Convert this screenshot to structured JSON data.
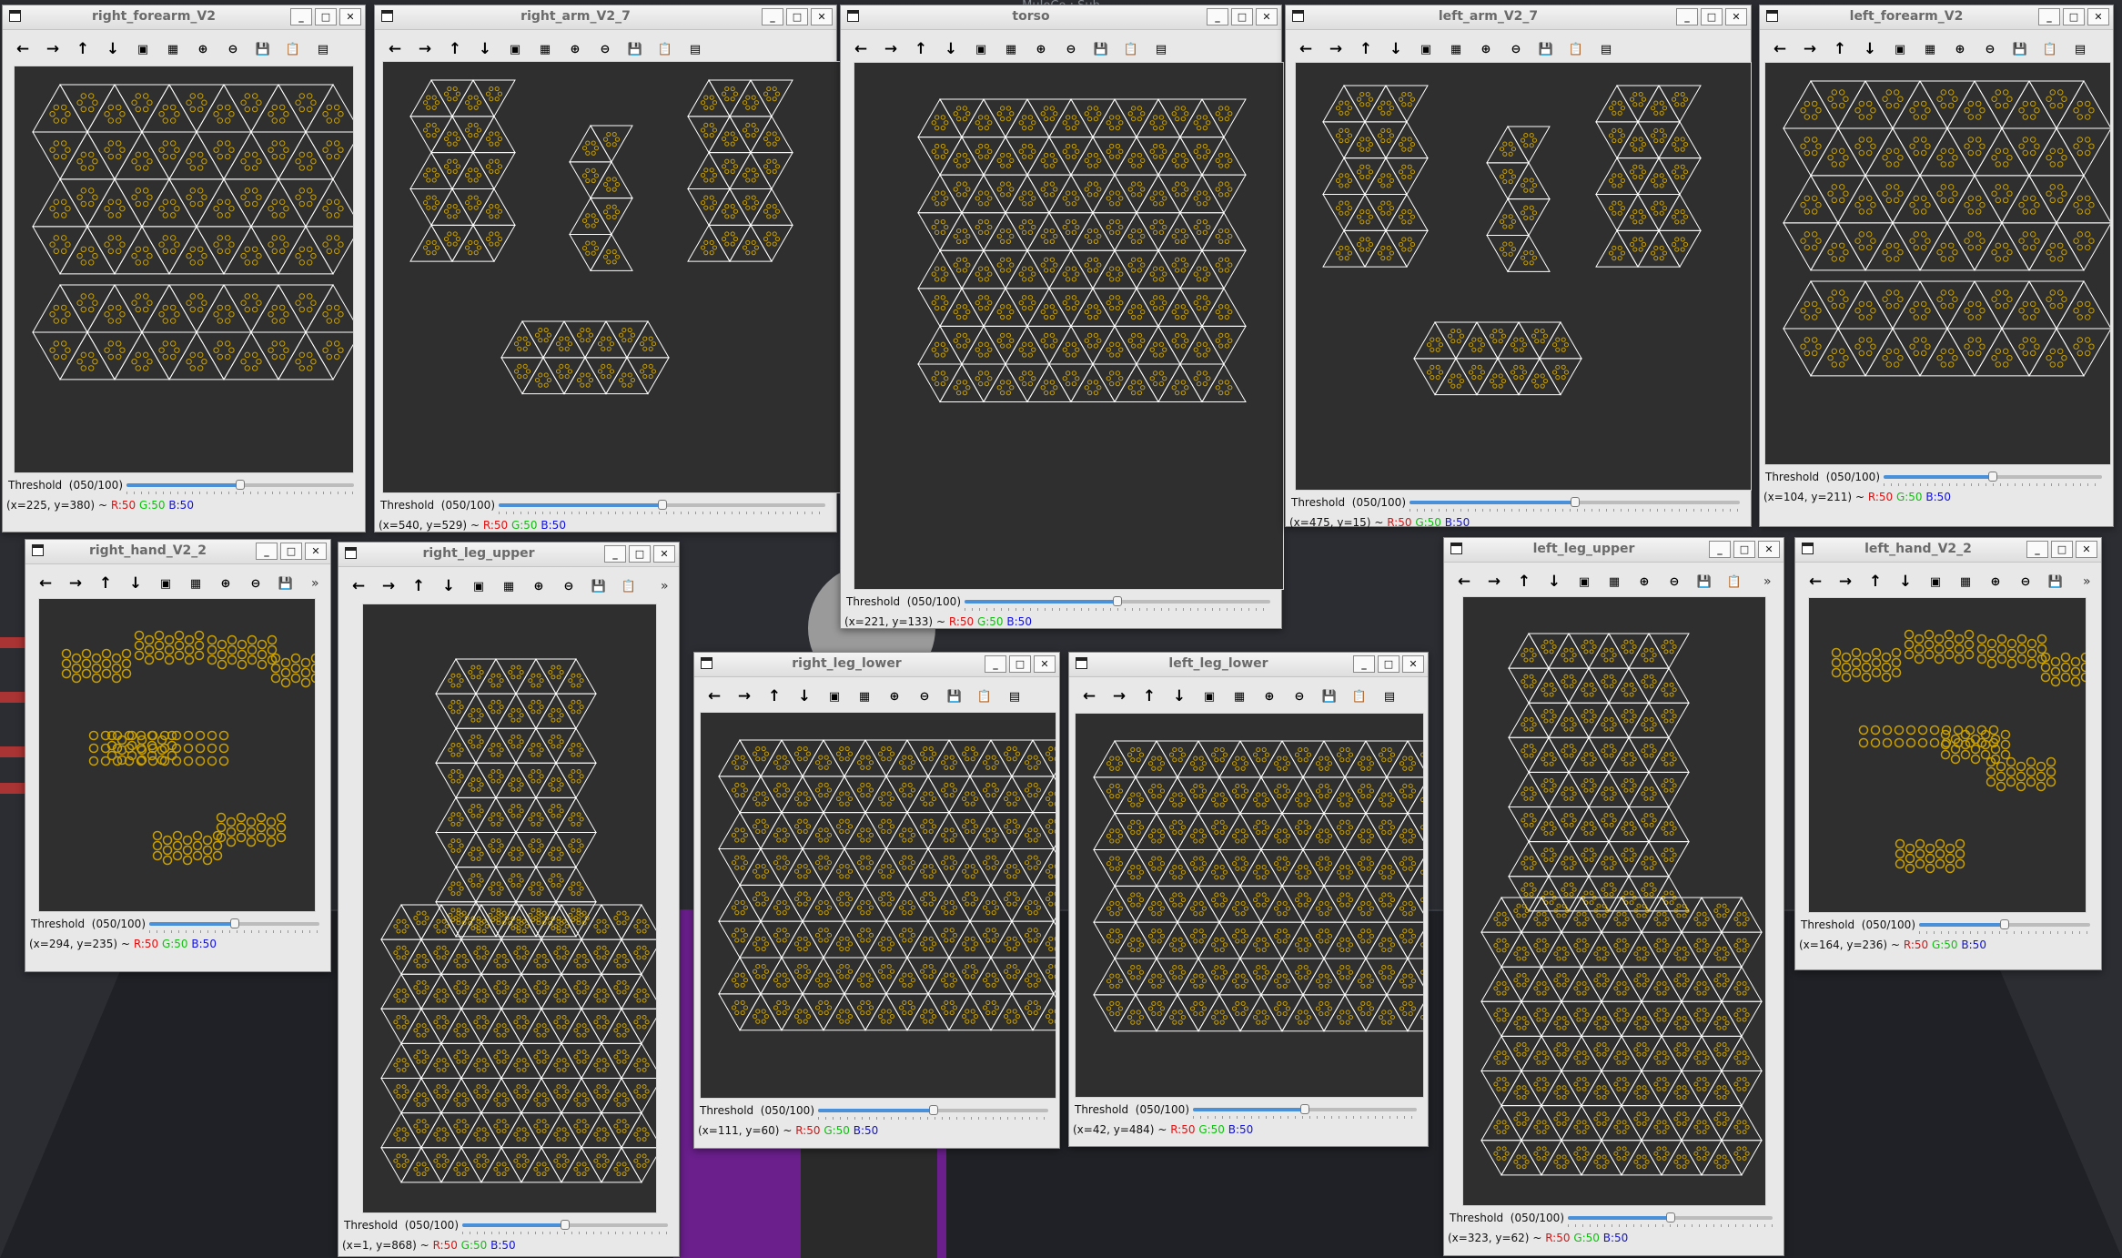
{
  "desktop": {
    "title": "MuJoCo : Sub"
  },
  "toolbar_icons": [
    "arrow-left-icon",
    "arrow-right-icon",
    "arrow-up-icon",
    "arrow-down-icon",
    "image-icon",
    "save-image-icon",
    "zoom-in-icon",
    "zoom-out-icon",
    "save-icon",
    "clipboard-icon",
    "properties-icon"
  ],
  "toolbar_glyphs": [
    "←",
    "→",
    "↑",
    "↓",
    "▣",
    "▦",
    "⊕",
    "⊖",
    "💾",
    "📋",
    "▤"
  ],
  "colors": {
    "canvas": "#2f2f2f",
    "taxel": "#c9a000",
    "edge": "#ffffff",
    "accent": "#4a90d9"
  },
  "windows": [
    {
      "id": "right_forearm",
      "title": "right_forearm_V2",
      "threshold_label": "Threshold",
      "threshold_value": "(050/100)",
      "slider_level": 0.5,
      "coords": "(x=225, y=380)",
      "sep": "~",
      "r": "R:50",
      "g": "G:50",
      "b": "B:50"
    },
    {
      "id": "right_arm",
      "title": "right_arm_V2_7",
      "threshold_label": "Threshold",
      "threshold_value": "(050/100)",
      "slider_level": 0.5,
      "coords": "(x=540, y=529)",
      "sep": "~",
      "r": "R:50",
      "g": "G:50",
      "b": "B:50"
    },
    {
      "id": "torso",
      "title": "torso",
      "threshold_label": "Threshold",
      "threshold_value": "(050/100)",
      "slider_level": 0.5,
      "coords": "(x=221, y=133)",
      "sep": "~",
      "r": "R:50",
      "g": "G:50",
      "b": "B:50"
    },
    {
      "id": "left_arm",
      "title": "left_arm_V2_7",
      "threshold_label": "Threshold",
      "threshold_value": "(050/100)",
      "slider_level": 0.5,
      "coords": "(x=475, y=15)",
      "sep": "~",
      "r": "R:50",
      "g": "G:50",
      "b": "B:50"
    },
    {
      "id": "left_forearm",
      "title": "left_forearm_V2",
      "threshold_label": "Threshold",
      "threshold_value": "(050/100)",
      "slider_level": 0.5,
      "coords": "(x=104, y=211)",
      "sep": "~",
      "r": "R:50",
      "g": "G:50",
      "b": "B:50"
    },
    {
      "id": "right_hand",
      "title": "right_hand_V2_2",
      "threshold_label": "Threshold",
      "threshold_value": "(050/100)",
      "slider_level": 0.5,
      "coords": "(x=294, y=235)",
      "sep": "~",
      "r": "R:50",
      "g": "G:50",
      "b": "B:50"
    },
    {
      "id": "right_leg_upper",
      "title": "right_leg_upper",
      "threshold_label": "Threshold",
      "threshold_value": "(050/100)",
      "slider_level": 0.5,
      "coords": "(x=1, y=868)",
      "sep": "~",
      "r": "R:50",
      "g": "G:50",
      "b": "B:50"
    },
    {
      "id": "right_leg_lower",
      "title": "right_leg_lower",
      "threshold_label": "Threshold",
      "threshold_value": "(050/100)",
      "slider_level": 0.5,
      "coords": "(x=111, y=60)",
      "sep": "~",
      "r": "R:50",
      "g": "G:50",
      "b": "B:50"
    },
    {
      "id": "left_leg_lower",
      "title": "left_leg_lower",
      "threshold_label": "Threshold",
      "threshold_value": "(050/100)",
      "slider_level": 0.5,
      "coords": "(x=42, y=484)",
      "sep": "~",
      "r": "R:50",
      "g": "G:50",
      "b": "B:50"
    },
    {
      "id": "left_leg_upper",
      "title": "left_leg_upper",
      "threshold_label": "Threshold",
      "threshold_value": "(050/100)",
      "slider_level": 0.5,
      "coords": "(x=323, y=62)",
      "sep": "~",
      "r": "R:50",
      "g": "G:50",
      "b": "B:50"
    },
    {
      "id": "left_hand",
      "title": "left_hand_V2_2",
      "threshold_label": "Threshold",
      "threshold_value": "(050/100)",
      "slider_level": 0.5,
      "coords": "(x=164, y=236)",
      "sep": "~",
      "r": "R:50",
      "g": "G:50",
      "b": "B:50"
    }
  ]
}
